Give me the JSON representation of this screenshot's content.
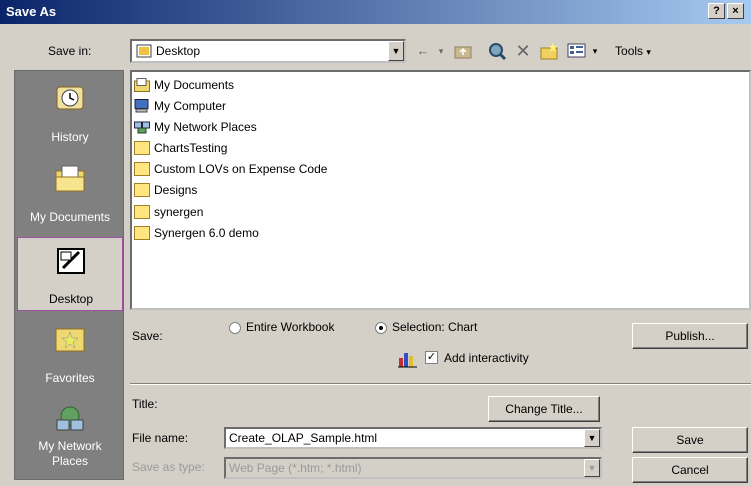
{
  "window": {
    "title": "Save As",
    "help_button": "?",
    "close_button": "×"
  },
  "save_in": {
    "label": "Save in:",
    "value": "Desktop"
  },
  "toolbar": {
    "tools_label": "Tools"
  },
  "places": [
    {
      "label": "History",
      "icon": "history-icon"
    },
    {
      "label": "My Documents",
      "icon": "my-documents-icon"
    },
    {
      "label": "Desktop",
      "icon": "desktop-icon"
    },
    {
      "label": "Favorites",
      "icon": "favorites-icon"
    },
    {
      "label": "My Network Places",
      "icon": "network-places-icon"
    }
  ],
  "files": [
    {
      "name": "My Documents",
      "icon": "my-documents-icon"
    },
    {
      "name": "My Computer",
      "icon": "computer-icon"
    },
    {
      "name": "My Network Places",
      "icon": "network-places-icon"
    },
    {
      "name": "ChartsTesting",
      "icon": "folder-icon"
    },
    {
      "name": "Custom LOVs on Expense Code",
      "icon": "folder-icon"
    },
    {
      "name": "Designs",
      "icon": "folder-icon"
    },
    {
      "name": "synergen",
      "icon": "folder-icon"
    },
    {
      "name": "Synergen 6.0 demo",
      "icon": "folder-icon"
    }
  ],
  "save_options": {
    "label": "Save:",
    "entire_workbook": "Entire Workbook",
    "selection": "Selection: Chart",
    "add_interactivity": "Add interactivity",
    "selected": "selection"
  },
  "publish_button": "Publish...",
  "title": {
    "label": "Title:",
    "change_button": "Change Title..."
  },
  "file_name": {
    "label": "File name:",
    "value": "Create_OLAP_Sample.html"
  },
  "save_as_type": {
    "label": "Save as type:",
    "value": "Web Page (*.htm; *.html)"
  },
  "save_button": "Save",
  "cancel_button": "Cancel"
}
